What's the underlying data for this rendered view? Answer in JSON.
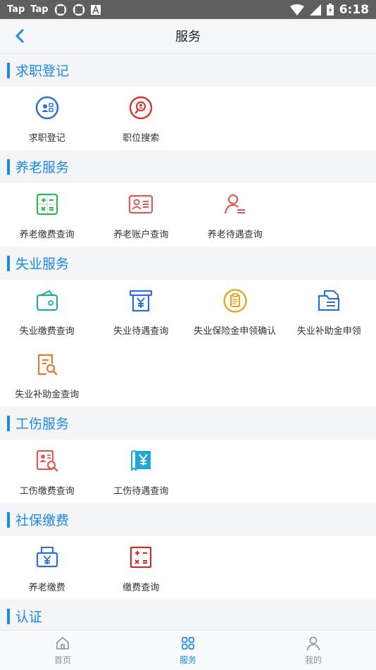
{
  "status_bar": {
    "app1": "Tap",
    "app2": "Tap",
    "time": "6:18"
  },
  "nav": {
    "title": "服务"
  },
  "sections": [
    {
      "title": "求职登记",
      "items": [
        {
          "label": "求职登记",
          "icon": "person-register-icon"
        },
        {
          "label": "职位搜索",
          "icon": "job-search-icon"
        }
      ]
    },
    {
      "title": "养老服务",
      "items": [
        {
          "label": "养老缴费查询",
          "icon": "calculator-icon"
        },
        {
          "label": "养老账户查询",
          "icon": "id-card-icon"
        },
        {
          "label": "养老待遇查询",
          "icon": "user-list-icon"
        }
      ]
    },
    {
      "title": "失业服务",
      "items": [
        {
          "label": "失业缴费查询",
          "icon": "wallet-icon"
        },
        {
          "label": "失业待遇查询",
          "icon": "yuan-receipt-icon"
        },
        {
          "label": "失业保险金申领确认",
          "icon": "clipboard-icon"
        },
        {
          "label": "失业补助金申领",
          "icon": "folder-doc-icon"
        },
        {
          "label": "失业补助金查询",
          "icon": "doc-search-icon"
        }
      ]
    },
    {
      "title": "工伤服务",
      "items": [
        {
          "label": "工伤缴费查询",
          "icon": "card-search-icon"
        },
        {
          "label": "工伤待遇查询",
          "icon": "yuan-doc-icon"
        }
      ]
    },
    {
      "title": "社保缴费",
      "items": [
        {
          "label": "养老缴费",
          "icon": "yuan-printer-icon"
        },
        {
          "label": "缴费查询",
          "icon": "calculator-icon"
        }
      ]
    },
    {
      "title": "认证",
      "items": []
    }
  ],
  "tabs": [
    {
      "label": "首页",
      "icon": "home-icon",
      "active": false
    },
    {
      "label": "服务",
      "icon": "grid-icon",
      "active": true
    },
    {
      "label": "我的",
      "icon": "user-icon",
      "active": false
    }
  ]
}
